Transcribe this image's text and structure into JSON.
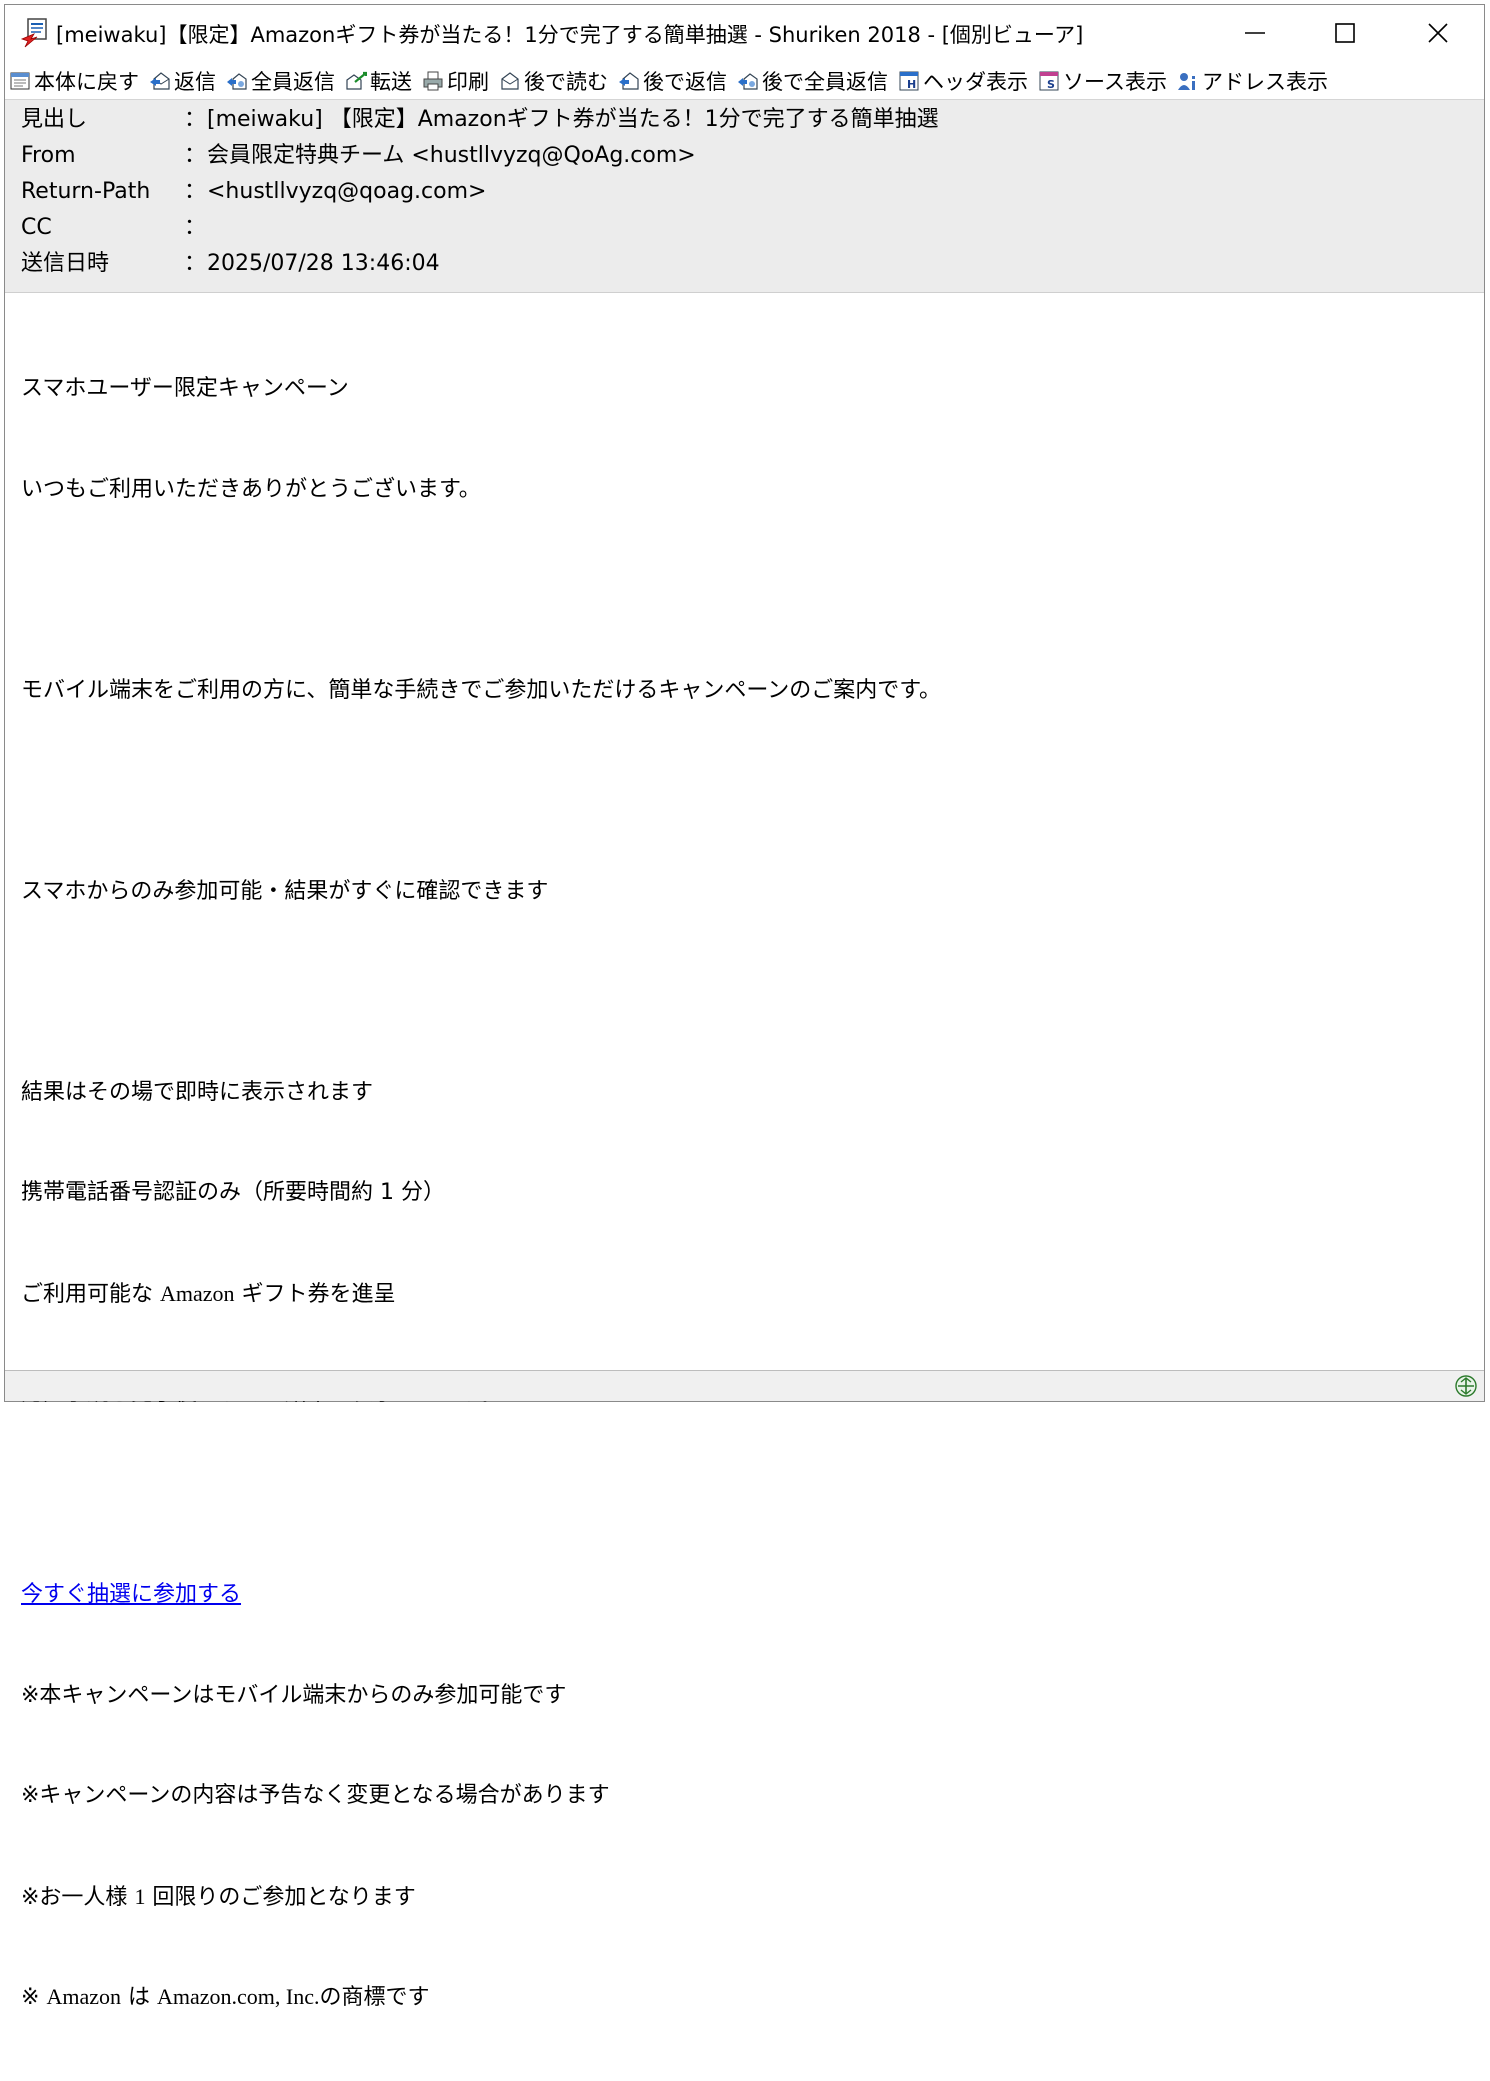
{
  "window": {
    "title": "[meiwaku]【限定】Amazonギフト券が当たる！1分で完了する簡単抽選 - Shuriken 2018 - [個別ビューア]",
    "icons": {
      "app": "mail-document-icon",
      "minimize": "minimize-icon",
      "maximize": "maximize-icon",
      "close": "close-icon"
    }
  },
  "toolbar": {
    "items": [
      {
        "label": "本体に戻す",
        "icon": "return-to-main-icon"
      },
      {
        "label": "返信",
        "icon": "reply-icon"
      },
      {
        "label": "全員返信",
        "icon": "reply-all-icon"
      },
      {
        "label": "転送",
        "icon": "forward-icon"
      },
      {
        "label": "印刷",
        "icon": "print-icon"
      },
      {
        "label": "後で読む",
        "icon": "read-later-icon"
      },
      {
        "label": "後で返信",
        "icon": "reply-later-icon"
      },
      {
        "label": "後で全員返信",
        "icon": "reply-all-later-icon"
      },
      {
        "label": "ヘッダ表示",
        "icon": "header-view-icon"
      },
      {
        "label": "ソース表示",
        "icon": "source-view-icon"
      },
      {
        "label": "アドレス表示",
        "icon": "address-view-icon"
      }
    ]
  },
  "headers": {
    "colon": "：",
    "subject": {
      "label": "見出し",
      "value": "[meiwaku] 【限定】Amazonギフト券が当たる！1分で完了する簡単抽選"
    },
    "from": {
      "label": "From",
      "value": "会員限定特典チーム <hustllvyzq@QoAg.com>"
    },
    "return_path": {
      "label": "Return-Path",
      "value": "<hustllvyzq@qoag.com>"
    },
    "cc": {
      "label": "CC",
      "value": ""
    },
    "date": {
      "label": "送信日時",
      "value": "2025/07/28 13:46:04"
    }
  },
  "body": {
    "line1": "スマホユーザー限定キャンペーン",
    "line2": "いつもご利用いただきありがとうございます。",
    "line4": "モバイル端末をご利用の方に、簡単な手続きでご参加いただけるキャンペーンのご案内です。",
    "line6": "スマホからのみ参加可能・結果がすぐに確認できます",
    "line8": "結果はその場で即時に表示されます",
    "line9": "携帯電話番号認証のみ（所要時間約 1 分）",
    "line10_a": "ご利用可能な ",
    "line10_b": "Amazon",
    "line10_c": " ギフト券を進呈",
    "line11": "認証手続き完了後、すぐに結果が表示されます。",
    "link": "今すぐ抽選に参加する",
    "note1": "※本キャンペーンはモバイル端末からのみ参加可能です",
    "note2": "※キャンペーンの内容は予告なく変更となる場合があります",
    "note3_a": "※お一人様 ",
    "note3_b": "1",
    "note3_c": " 回限りのご参加となります",
    "note4_a": "※ ",
    "note4_b": "Amazon",
    "note4_c": " は ",
    "note4_d": "Amazon.com, Inc.",
    "note4_e": "の商標です"
  },
  "statusbar": {
    "icon": "connection-status-icon"
  }
}
